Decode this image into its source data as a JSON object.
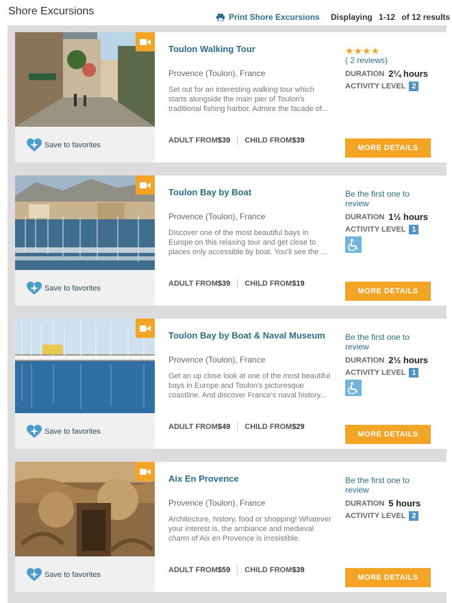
{
  "header": {
    "title": "Shore Excursions",
    "print_label": "Print Shore Excursions",
    "displaying_label": "Displaying",
    "range": "1-12",
    "of_label": "of 12 results"
  },
  "colors": {
    "accent": "#f3a425",
    "link": "#2a6e8c",
    "level_badge": "#4f93c4",
    "list_background": "#dcdcdc"
  },
  "excursions": [
    {
      "name": "Toulon Walking Tour",
      "location": "Provence (Toulon), France",
      "description": "Set out for an interesting walking tour which starts alongside the main pier of Toulon's traditional fishing harbor. Admire the facade of...",
      "adult_label": "ADULT FROM",
      "adult_price": "$39",
      "child_label": "CHILD FROM",
      "child_price": "$39",
      "stars": "★★★★",
      "rating": 4,
      "reviews": "( 2 reviews)",
      "duration_label": "DURATION",
      "duration": "2¼ hours",
      "activity_label": "ACTIVITY LEVEL",
      "activity_level": "2",
      "wheelchair_accessible": false,
      "favorite_label": "Save to favorites",
      "more_label": "MORE DETAILS",
      "video_icon": "video-camera-icon"
    },
    {
      "name": "Toulon Bay by Boat",
      "location": "Provence (Toulon), France",
      "description": "Discover one of the most beautiful bays in Europe on this relaxing tour and get close to places only accessible by boat. You'll see the ...",
      "adult_label": "ADULT FROM",
      "adult_price": "$39",
      "child_label": "CHILD FROM",
      "child_price": "$19",
      "first_review": "Be the first one to review",
      "duration_label": "DURATION",
      "duration": "1½ hours",
      "activity_label": "ACTIVITY LEVEL",
      "activity_level": "1",
      "wheelchair_accessible": true,
      "favorite_label": "Save to favorites",
      "more_label": "MORE DETAILS",
      "video_icon": "video-camera-icon"
    },
    {
      "name": "Toulon Bay by Boat & Naval Museum",
      "location": "Provence (Toulon), France",
      "description": "Get an up close look at one of the most beautiful bays in Europe and Toulon's picturesque coastline. And discover France's naval history...",
      "adult_label": "ADULT FROM",
      "adult_price": "$49",
      "child_label": "CHILD FROM",
      "child_price": "$29",
      "first_review": "Be the first one to review",
      "duration_label": "DURATION",
      "duration": "2½ hours",
      "activity_label": "ACTIVITY LEVEL",
      "activity_level": "1",
      "wheelchair_accessible": true,
      "favorite_label": "Save to favorites",
      "more_label": "MORE DETAILS",
      "video_icon": "video-camera-icon"
    },
    {
      "name": "Aix En Provence",
      "location": "Provence (Toulon), France",
      "description": "Architecture, history, food or shopping! Whatever your interest is, the ambiance and medieval charm of Aix en Provence is irresistible.",
      "adult_label": "ADULT FROM",
      "adult_price": "$59",
      "child_label": "CHILD FROM",
      "child_price": "$39",
      "first_review": "Be the first one to review",
      "duration_label": "DURATION",
      "duration": "5 hours",
      "activity_label": "ACTIVITY LEVEL",
      "activity_level": "2",
      "wheelchair_accessible": false,
      "favorite_label": "Save to favorites",
      "more_label": "MORE DETAILS",
      "video_icon": "video-camera-icon"
    }
  ]
}
